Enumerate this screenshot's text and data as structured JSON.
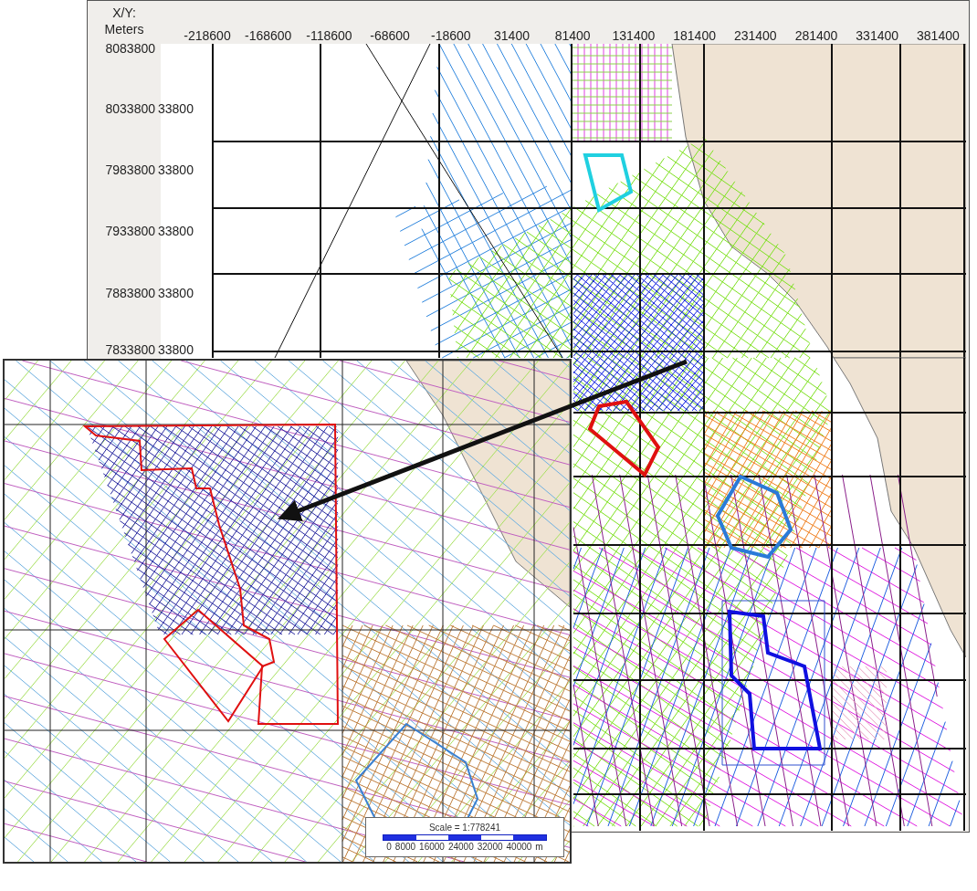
{
  "ruler": {
    "corner_label": [
      "X/Y:",
      "Meters"
    ],
    "x_labels": [
      "-218600",
      "-168600",
      "-118600",
      "-68600",
      "-18600",
      "31400",
      "81400",
      "131400",
      "181400",
      "231400",
      "281400",
      "331400",
      "381400"
    ],
    "y_labels": [
      "8083800",
      "8033800",
      "7983800",
      "7933800",
      "7883800",
      "7833800"
    ]
  },
  "ghost_labels": [
    "33800",
    "33800",
    "33800",
    "33800",
    "33800"
  ],
  "scale_bar": {
    "title": "Scale = 1:778241",
    "labels": [
      "0",
      "8000",
      "16000",
      "24000",
      "32000",
      "40000",
      "m"
    ]
  }
}
